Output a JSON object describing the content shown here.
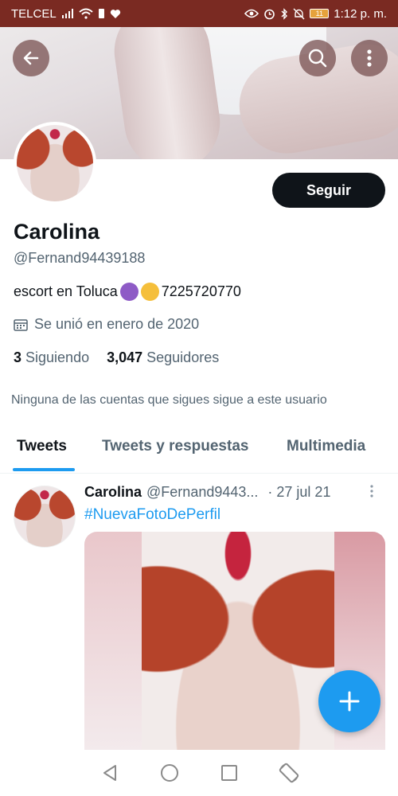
{
  "status_bar": {
    "carrier": "TELCEL",
    "battery": "11",
    "time": "1:12 p. m."
  },
  "profile": {
    "display_name": "Carolina",
    "handle": "@Fernand94439188",
    "bio_prefix": "escort en Toluca",
    "bio_suffix": "7225720770",
    "joined": "Se unió en enero de 2020",
    "following_count": "3",
    "following_label": "Siguiendo",
    "followers_count": "3,047",
    "followers_label": "Seguidores",
    "mutual_note": "Ninguna de las cuentas que sigues sigue a este usuario",
    "follow_button": "Seguir"
  },
  "tabs": [
    {
      "label": "Tweets",
      "active": true
    },
    {
      "label": "Tweets y respuestas",
      "active": false
    },
    {
      "label": "Multimedia",
      "active": false
    }
  ],
  "tweet": {
    "name": "Carolina",
    "handle": "@Fernand9443...",
    "date": "· 27 jul 21",
    "hashtag": "#NuevaFotoDePerfil"
  },
  "icons": {
    "back": "arrow-left-icon",
    "search": "search-icon",
    "more": "more-vertical-icon",
    "compose": "plus-icon"
  },
  "colors": {
    "accent": "#1d9bf0",
    "follow_button": "#0f1419",
    "status_bar": "#7a2a22"
  }
}
